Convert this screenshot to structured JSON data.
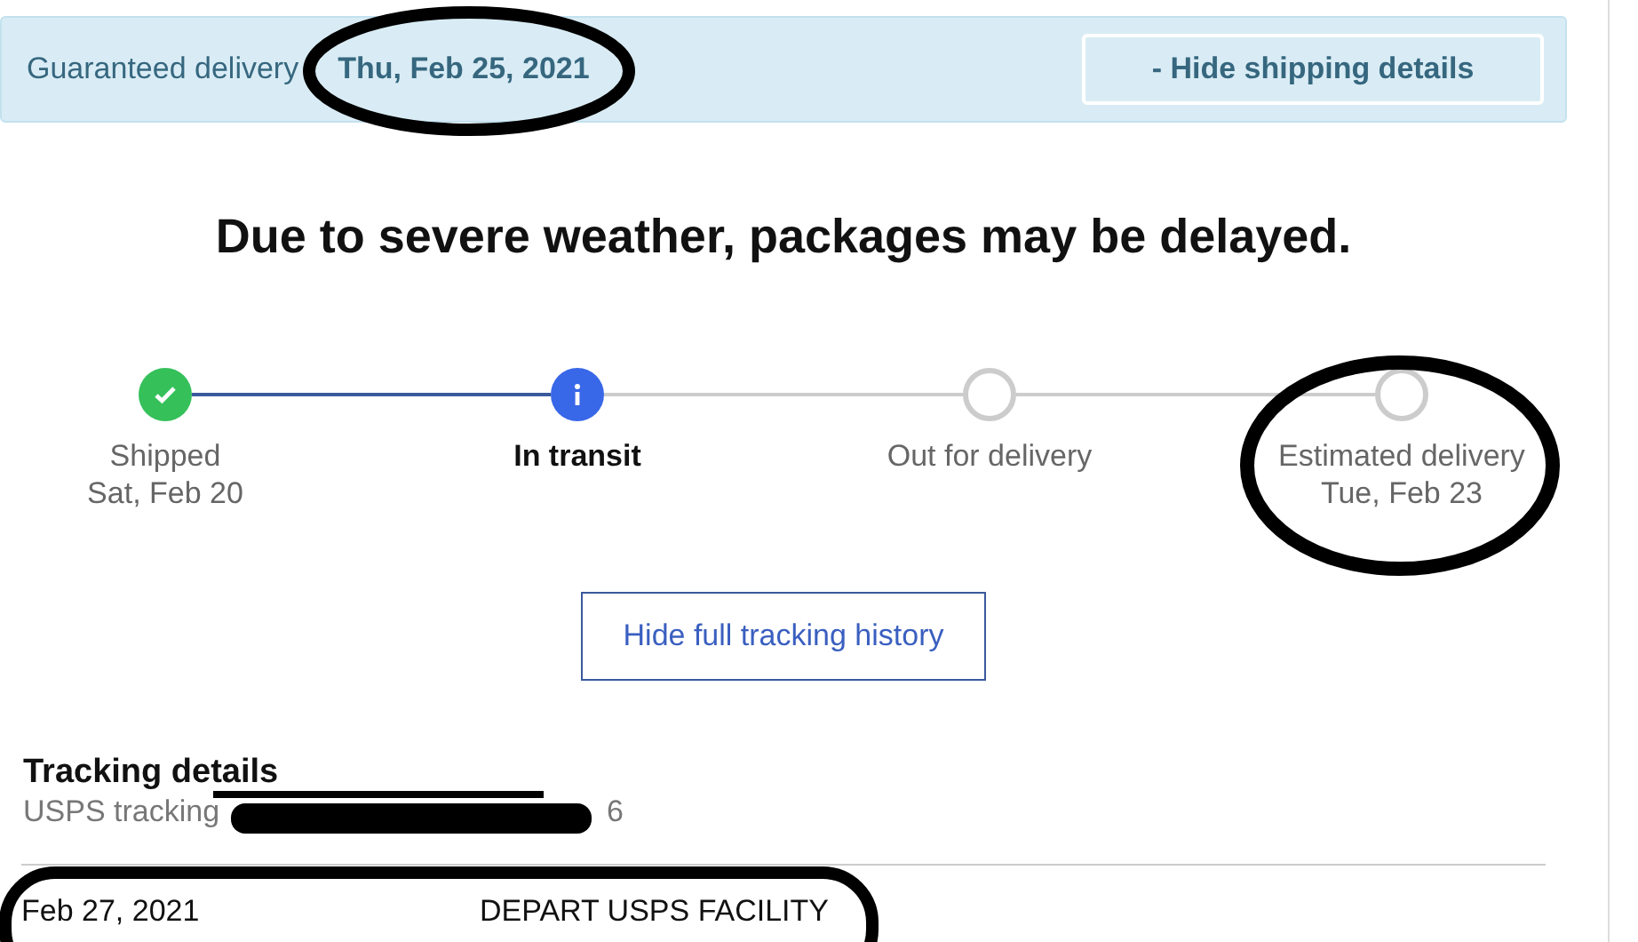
{
  "banner": {
    "label": "Guaranteed delivery",
    "date": "Thu, Feb 25, 2021",
    "button": "- Hide shipping details"
  },
  "headline": "Due to severe weather, packages may be delayed.",
  "steps": [
    {
      "kind": "done",
      "title": "Shipped",
      "date": "Sat, Feb 20"
    },
    {
      "kind": "current",
      "title": "In transit"
    },
    {
      "kind": "pending",
      "title": "Out for delivery"
    },
    {
      "kind": "pending",
      "title": "Estimated delivery",
      "date": "Tue, Feb 23"
    }
  ],
  "history_button": "Hide full tracking history",
  "tracking": {
    "heading": "Tracking details",
    "number_label": "USPS tracking",
    "number_tail": "6"
  },
  "events": [
    {
      "date": "Feb 27, 2021",
      "status": "DEPART USPS FACILITY"
    }
  ]
}
